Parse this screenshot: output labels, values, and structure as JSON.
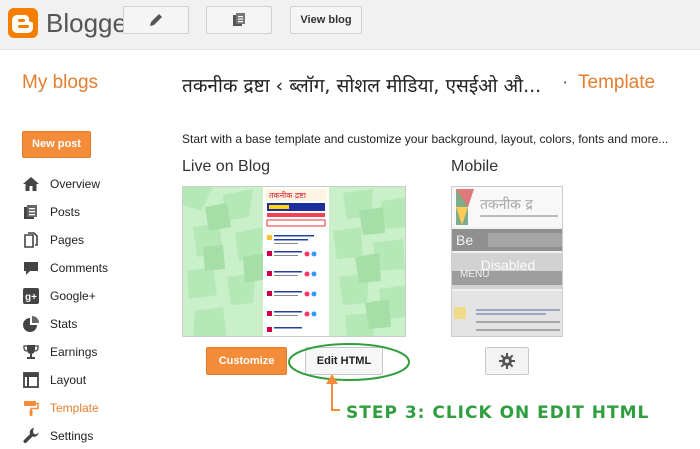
{
  "app": {
    "brand": "Blogger"
  },
  "toolbar": {
    "view_blog": "View blog"
  },
  "header": {
    "my_blogs": "My blogs",
    "blog_title": "तकनीक द्रष्टा ‹ ब्लॉग, सोशल मीडिया, एसईओ औ...",
    "separator": "·",
    "section": "Template"
  },
  "sidebar": {
    "new_post": "New post",
    "items": [
      {
        "label": "Overview",
        "icon": "home-icon"
      },
      {
        "label": "Posts",
        "icon": "posts-icon"
      },
      {
        "label": "Pages",
        "icon": "pages-icon"
      },
      {
        "label": "Comments",
        "icon": "comment-icon"
      },
      {
        "label": "Google+",
        "icon": "google-plus-icon"
      },
      {
        "label": "Stats",
        "icon": "pie-chart-icon"
      },
      {
        "label": "Earnings",
        "icon": "trophy-icon"
      },
      {
        "label": "Layout",
        "icon": "layout-icon"
      },
      {
        "label": "Template",
        "icon": "paint-roller-icon",
        "active": true
      },
      {
        "label": "Settings",
        "icon": "wrench-icon"
      }
    ]
  },
  "main": {
    "intro": "Start with a base template and customize your background, layout, colors, fonts and more...",
    "live_title": "Live on Blog",
    "mobile_title": "Mobile",
    "customize": "Customize",
    "edit_html": "Edit HTML",
    "mobile_disabled": "Disabled",
    "mobile_menu": "MENU"
  },
  "annotation": {
    "step": "STEP 3: CLICK ON EDIT HTML"
  },
  "colors": {
    "accent": "#f58c3a",
    "annotation": "#2e9e3e",
    "logo": "#f57d00"
  }
}
